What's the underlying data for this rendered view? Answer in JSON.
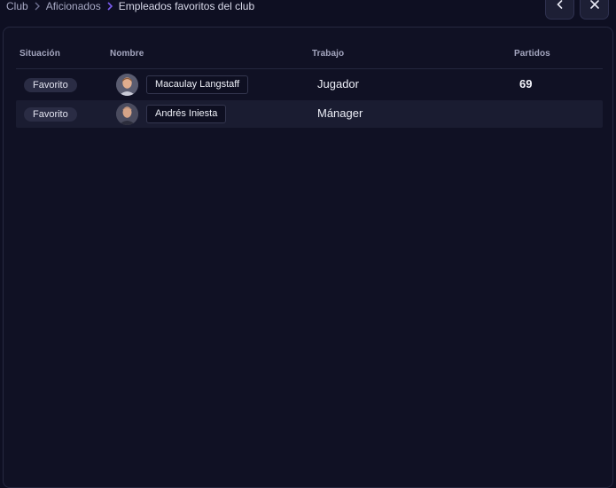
{
  "breadcrumb": {
    "items": [
      "Club",
      "Aficionados",
      "Empleados favoritos del club"
    ]
  },
  "nav": {
    "back_icon": "chevron-left-icon",
    "close_icon": "close-icon"
  },
  "table": {
    "headers": {
      "status": "Situación",
      "name": "Nombre",
      "job": "Trabajo",
      "matches": "Partidos"
    },
    "rows": [
      {
        "status": "Favorito",
        "name": "Macaulay Langstaff",
        "job": "Jugador",
        "matches": "69"
      },
      {
        "status": "Favorito",
        "name": "Andrés Iniesta",
        "job": "Mánager",
        "matches": ""
      }
    ]
  },
  "colors": {
    "background": "#0e0f22",
    "panel": "#101124",
    "highlight_row": "#1a1c31",
    "accent_chevron": "#7b5cf0"
  }
}
